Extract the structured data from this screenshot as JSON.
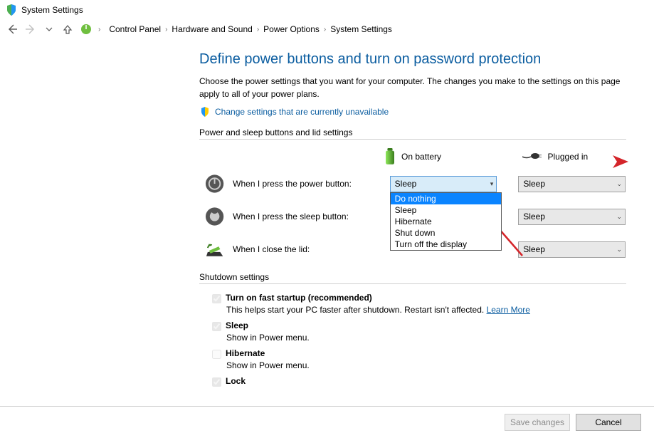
{
  "window": {
    "title": "System Settings"
  },
  "breadcrumbs": [
    "Control Panel",
    "Hardware and Sound",
    "Power Options",
    "System Settings"
  ],
  "page": {
    "title": "Define power buttons and turn on password protection",
    "description": "Choose the power settings that you want for your computer. The changes you make to the settings on this page apply to all of your power plans.",
    "change_link": "Change settings that are currently unavailable",
    "section_power": "Power and sleep buttons and lid settings",
    "col_battery": "On battery",
    "col_plugged": "Plugged in",
    "row_power": "When I press the power button:",
    "row_sleep": "When I press the sleep button:",
    "row_lid": "When I close the lid:",
    "dropdown_value": "Sleep",
    "options": [
      "Do nothing",
      "Sleep",
      "Hibernate",
      "Shut down",
      "Turn off the display"
    ],
    "section_shutdown": "Shutdown settings",
    "chk_fast": "Turn on fast startup (recommended)",
    "desc_fast": "This helps start your PC faster after shutdown. Restart isn't affected. ",
    "learn_more": "Learn More",
    "chk_sleep": "Sleep",
    "desc_sleep": "Show in Power menu.",
    "chk_hibernate": "Hibernate",
    "desc_hibernate": "Show in Power menu.",
    "chk_lock": "Lock"
  },
  "footer": {
    "save": "Save changes",
    "cancel": "Cancel"
  }
}
